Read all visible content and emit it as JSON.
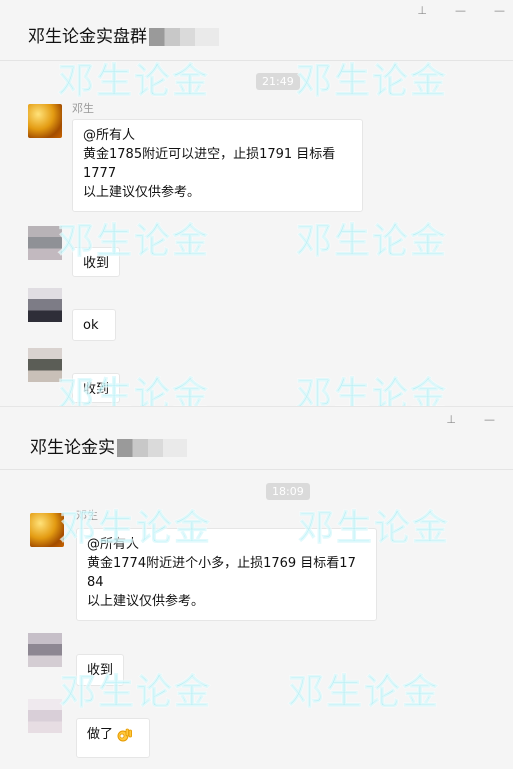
{
  "chat1": {
    "title": "邓生论金实盘群",
    "time": "21:49",
    "sender": "邓生",
    "messages": {
      "main": [
        "@所有人",
        "黄金1785附近可以进空，止损1791   目标看",
        "1777",
        "以上建议仅供参考。"
      ],
      "reply1": "收到",
      "reply2": "ok",
      "reply3": "收到"
    }
  },
  "chat2": {
    "title": "邓生论金实",
    "time": "18:09",
    "sender": "邓生",
    "messages": {
      "main": [
        "@所有人",
        "黄金1774附近进个小多，止损1769  目标看17",
        "84",
        "以上建议仅供参考。"
      ],
      "reply1": "收到",
      "reply2": "做了"
    }
  },
  "window_icons": {
    "pin": "⊥",
    "close": "—"
  },
  "watermark": "邓生论金",
  "colors": {
    "watermark": "#7fe6ef",
    "avatar_gold": "#e39b12"
  }
}
